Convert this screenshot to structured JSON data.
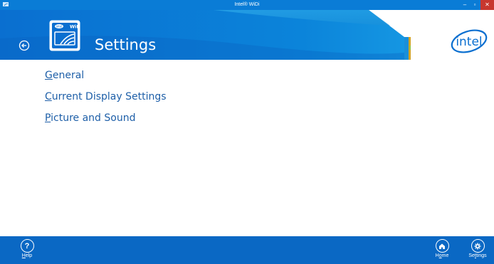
{
  "window": {
    "title": "Intel® WiDi",
    "minimize_glyph": "–",
    "maximize_glyph": "▫",
    "close_glyph": "✕"
  },
  "header": {
    "page_title": "Settings",
    "widi_badge": "WiDi",
    "intel_logo_text": "intel"
  },
  "menu": {
    "items": [
      {
        "accesskey": "G",
        "rest": "eneral"
      },
      {
        "accesskey": "C",
        "rest": "urrent Display Settings"
      },
      {
        "accesskey": "P",
        "rest": "icture and Sound"
      }
    ]
  },
  "appbar": {
    "help": {
      "glyph": "?",
      "accesskey": "H",
      "rest": "elp"
    },
    "home": {
      "pre": "H",
      "accesskey": "o",
      "rest": "me"
    },
    "settings": {
      "pre": "Se",
      "accesskey": "t",
      "rest": "tings"
    }
  },
  "colors": {
    "titlebar": "#0a7cd6",
    "banner": "#0a6fd0",
    "banner_light": "#35b3ee",
    "link": "#1e5fa8",
    "appbar": "#0a68c4",
    "close": "#c7372f"
  }
}
